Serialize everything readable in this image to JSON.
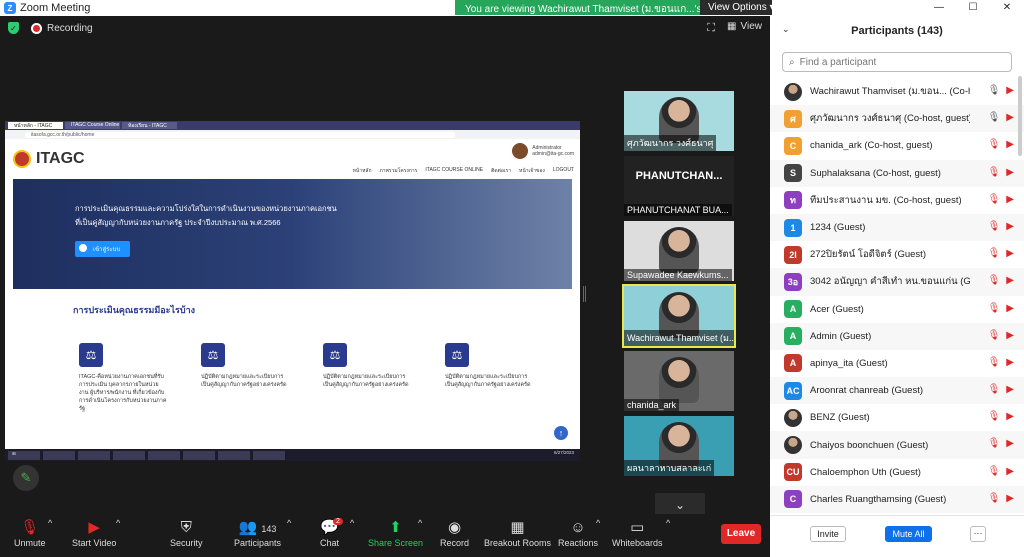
{
  "window": {
    "title": "Zoom Meeting",
    "banner": "You are viewing Wachirawut Thamviset (ม.ขอนแก...'s screen",
    "view_options": "View Options"
  },
  "topbar": {
    "recording": "Recording",
    "view": "View"
  },
  "shared_screen": {
    "tabs": [
      "หน้าหลัก - ITAGC",
      "ITAGC Course Online",
      "ห้องเรียน - ITAGC"
    ],
    "url": "itasofa.gcc.or.th/public/home",
    "site_logo": "ITAGC",
    "user_name": "Administrator",
    "user_email": "admin@ita-gc.com",
    "nav": [
      "หน้าหลัก",
      "ภาพรวมโครงการ",
      "ITAGC COURSE ONLINE",
      "ติดต่อเรา",
      "หน้าเจ้าของ",
      "LOGOUT"
    ],
    "hero_line1": "การประเมินคุณธรรมและความโปร่งใสในการดำเนินงานของหน่วยงานภาคเอกชน",
    "hero_line2": "ที่เป็นคู่สัญญากับหน่วยงานภาครัฐ ประจำปีงบประมาณ พ.ศ.2566",
    "hero_button": "เข้าสู่ระบบ",
    "section_title": "การประเมินคุณธรรมมีอะไรบ้าง",
    "cards": [
      "ITAGC-คือหน่วยงานภาคเอกชนที่รับการประเมิน บุคลากรภายในหน่วยงาน ผู้บริหาร/พนักงาน ที่เกี่ยวข้องกับการดำเนินโครงการกับหน่วยงานภาครัฐ",
      "ปฏิบัติตามกฎหมายและระเบียบการเป็นคู่สัญญากับภาครัฐอย่างเคร่งครัด",
      "ปฏิบัติตามกฎหมายและระเบียบการเป็นคู่สัญญากับภาครัฐอย่างเคร่งครัด",
      "ปฏิบัติตามกฎหมายและระเบียบการเป็นคู่สัญญากับภาครัฐอย่างเคร่งครัด"
    ],
    "clock": "6/27/2023"
  },
  "thumbnails": [
    {
      "name": "ศุภวัฒนากร วงศ์ธนาศุ",
      "bg": "#a7dbe0"
    },
    {
      "name": "PHANUTCHANAT BUA...",
      "big": "PHANUTCHAN...",
      "bg": "#222222"
    },
    {
      "name": "Supawadee Kaewkums...",
      "bg": "#dddddd"
    },
    {
      "name": "Wachirawut Thamviset (ม...",
      "bg": "#8fd0d8"
    },
    {
      "name": "chanida_ark",
      "bg": "#6a6a6a"
    },
    {
      "name": "ผลนาลาหาบสลาละเก่",
      "bg": "#3b9fb3"
    }
  ],
  "toolbar": {
    "unmute": "Unmute",
    "start_video": "Start Video",
    "security": "Security",
    "participants": "Participants",
    "participants_count": "143",
    "chat": "Chat",
    "chat_badge": "2",
    "share_screen": "Share Screen",
    "record": "Record",
    "breakout": "Breakout Rooms",
    "reactions": "Reactions",
    "whiteboards": "Whiteboards",
    "leave": "Leave"
  },
  "panel": {
    "title": "Participants (143)",
    "search_placeholder": "Find a participant",
    "participants": [
      {
        "initial": "",
        "name": "Wachirawut Thamviset (ม.ขอน...   (Co-host)",
        "color": "#555555",
        "photo": true
      },
      {
        "initial": "ศ",
        "name": "ศุภวัฒนากร วงศ์ธนาศุ (Co-host, guest)",
        "color": "#f0a030"
      },
      {
        "initial": "C",
        "name": "chanida_ark (Co-host, guest)",
        "color": "#f0a030"
      },
      {
        "initial": "S",
        "name": "Suphalaksana (Co-host, guest)",
        "color": "#444444"
      },
      {
        "initial": "ท",
        "name": "ทีมประสานงาน มข. (Co-host, guest)",
        "color": "#8e3fc0"
      },
      {
        "initial": "1",
        "name": "1234 (Guest)",
        "color": "#1e88e5"
      },
      {
        "initial": "2I",
        "name": "272ปิยรัตน์ โอดีจิตร์ (Guest)",
        "color": "#c0392b"
      },
      {
        "initial": "3อ",
        "name": "3042 อนัญญา คำสีเทำ หน.ขอนแก่น (Guest)",
        "color": "#8e3fc0"
      },
      {
        "initial": "A",
        "name": "Acer (Guest)",
        "color": "#27ae60"
      },
      {
        "initial": "A",
        "name": "Admin (Guest)",
        "color": "#27ae60"
      },
      {
        "initial": "A",
        "name": "apinya_ita (Guest)",
        "color": "#c0392b"
      },
      {
        "initial": "AC",
        "name": "Aroonrat chanreab (Guest)",
        "color": "#1e88e5"
      },
      {
        "initial": "",
        "name": "BENZ (Guest)",
        "color": "#555555",
        "photo": true
      },
      {
        "initial": "",
        "name": "Chaiyos boonchuen (Guest)",
        "color": "#555555",
        "photo": true
      },
      {
        "initial": "CU",
        "name": "Chaloemphon Uth (Guest)",
        "color": "#c0392b"
      },
      {
        "initial": "C",
        "name": "Charles Ruangthamsing (Guest)",
        "color": "#8e3fc0"
      }
    ],
    "invite": "Invite",
    "mute_all": "Mute All",
    "more": "···"
  }
}
